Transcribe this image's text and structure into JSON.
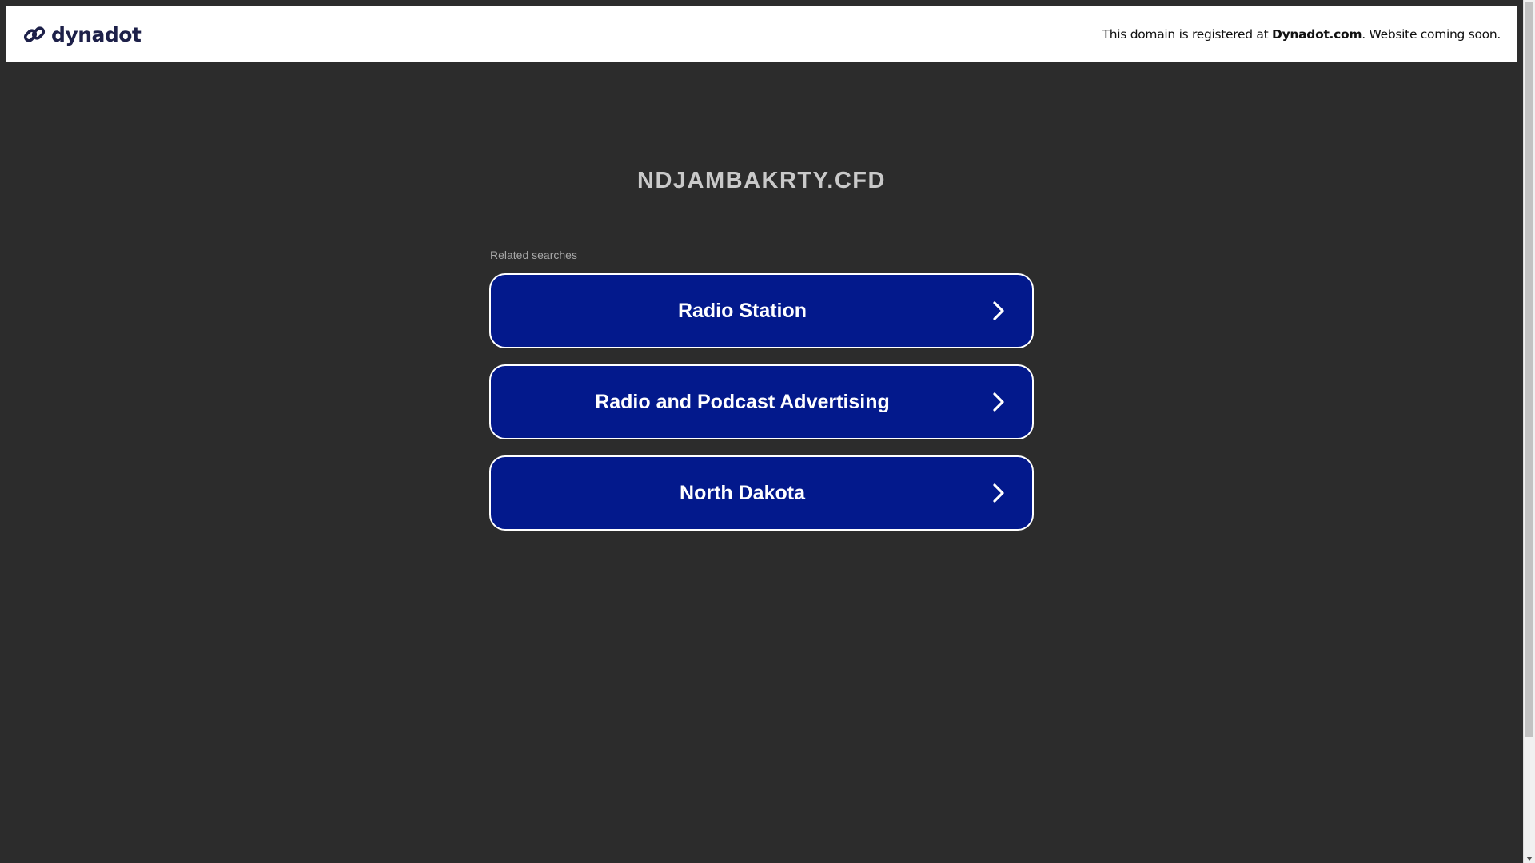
{
  "header": {
    "logo_text": "dynadot",
    "logo_icon": "dynadot-link-icon",
    "message_prefix": "This domain is registered at ",
    "message_brand": "Dynadot.com",
    "message_suffix": ". Website coming soon."
  },
  "main": {
    "domain": "NDJAMBAKRTY.CFD",
    "related_label": "Related searches",
    "searches": [
      {
        "label": "Radio Station"
      },
      {
        "label": "Radio and Podcast Advertising"
      },
      {
        "label": "North Dakota"
      }
    ]
  },
  "colors": {
    "background": "#2c2c2c",
    "button": "#03198c",
    "logo": "#1d2049"
  }
}
